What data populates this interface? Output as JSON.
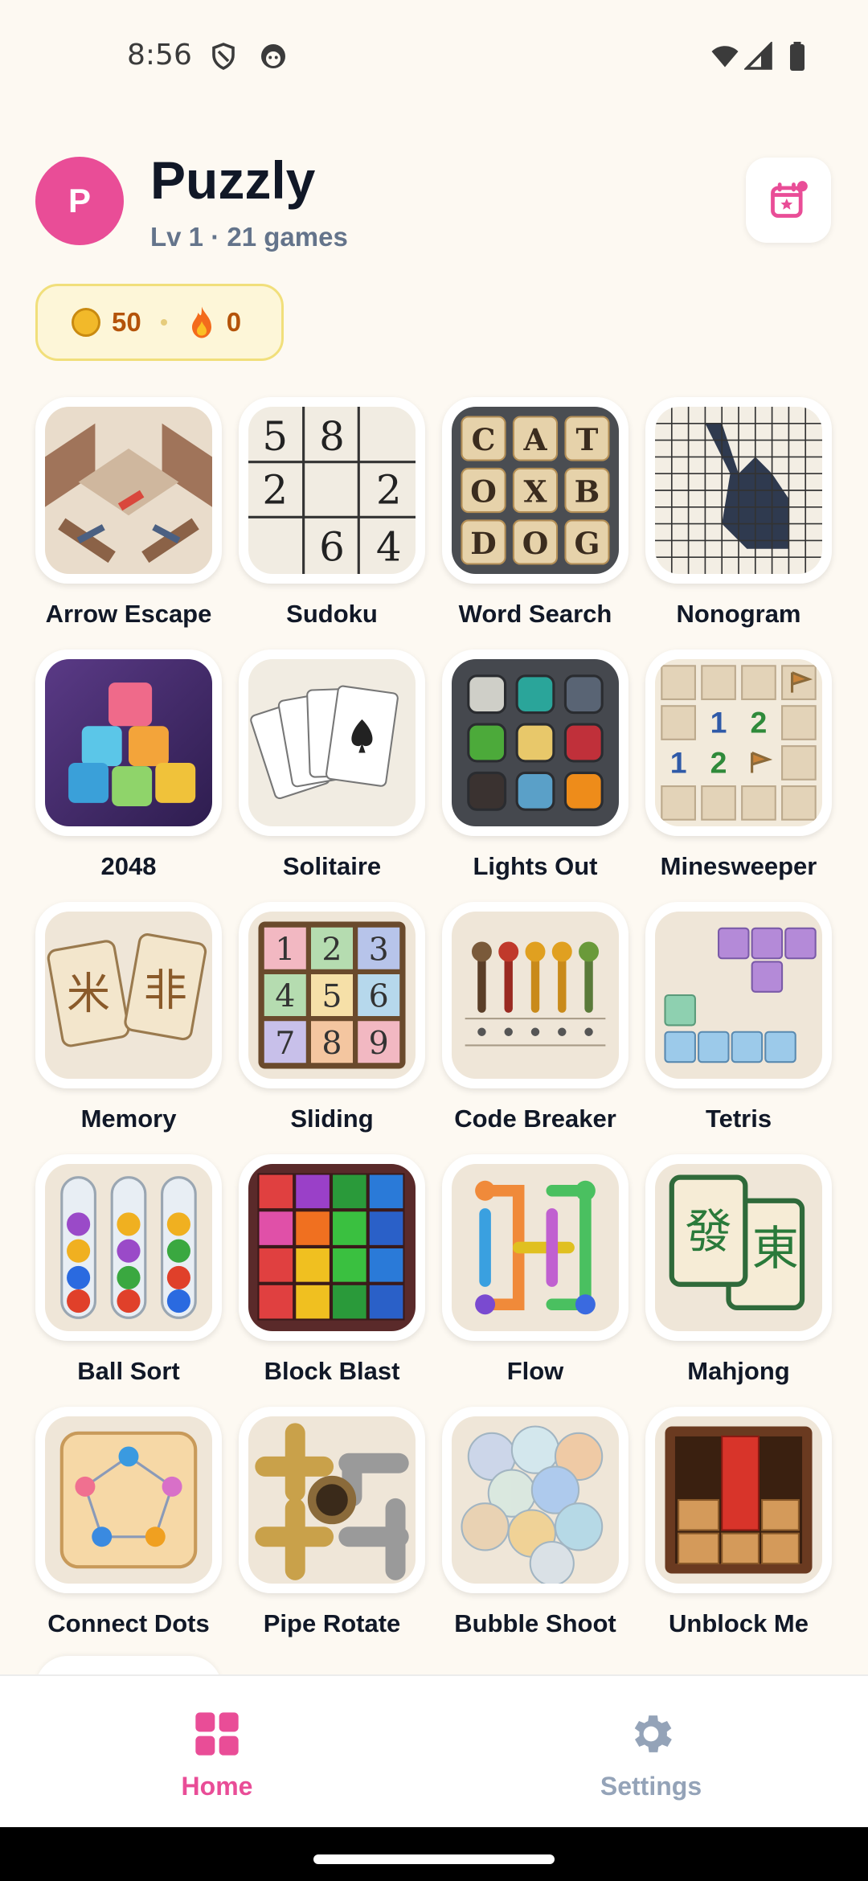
{
  "status": {
    "time": "8:56"
  },
  "header": {
    "avatar_letter": "P",
    "title": "Puzzly",
    "subtitle": "Lv 1 · 21 games"
  },
  "currency": {
    "coins": "50",
    "streak": "0"
  },
  "games": [
    {
      "label": "Arrow Escape",
      "icon": "arrow-maze"
    },
    {
      "label": "Sudoku",
      "icon": "sudoku-grid"
    },
    {
      "label": "Word Search",
      "icon": "letter-tiles"
    },
    {
      "label": "Nonogram",
      "icon": "pixel-grid"
    },
    {
      "label": "2048",
      "icon": "number-cubes"
    },
    {
      "label": "Solitaire",
      "icon": "playing-cards"
    },
    {
      "label": "Lights Out",
      "icon": "light-buttons"
    },
    {
      "label": "Minesweeper",
      "icon": "mine-grid"
    },
    {
      "label": "Memory",
      "icon": "memory-cards"
    },
    {
      "label": "Sliding",
      "icon": "sliding-tiles"
    },
    {
      "label": "Code Breaker",
      "icon": "code-pegs"
    },
    {
      "label": "Tetris",
      "icon": "tetromino"
    },
    {
      "label": "Ball Sort",
      "icon": "ball-tubes"
    },
    {
      "label": "Block Blast",
      "icon": "color-blocks"
    },
    {
      "label": "Flow",
      "icon": "flow-pipes"
    },
    {
      "label": "Mahjong",
      "icon": "mahjong-tiles"
    },
    {
      "label": "Connect Dots",
      "icon": "dots-board"
    },
    {
      "label": "Pipe Rotate",
      "icon": "metal-pipes"
    },
    {
      "label": "Bubble Shoot",
      "icon": "bubbles"
    },
    {
      "label": "Unblock Me",
      "icon": "wood-blocks"
    }
  ],
  "nav": {
    "home": "Home",
    "settings": "Settings"
  },
  "sudoku_digits": [
    "5",
    "8",
    "2",
    "2",
    "6",
    "4"
  ],
  "word_letters": [
    "C",
    "A",
    "T",
    "O",
    "X",
    "B",
    "D",
    "O",
    "G"
  ],
  "colors": {
    "accent": "#e94d97",
    "muted_nav": "#94a3b8",
    "coin_text": "#b45309"
  }
}
